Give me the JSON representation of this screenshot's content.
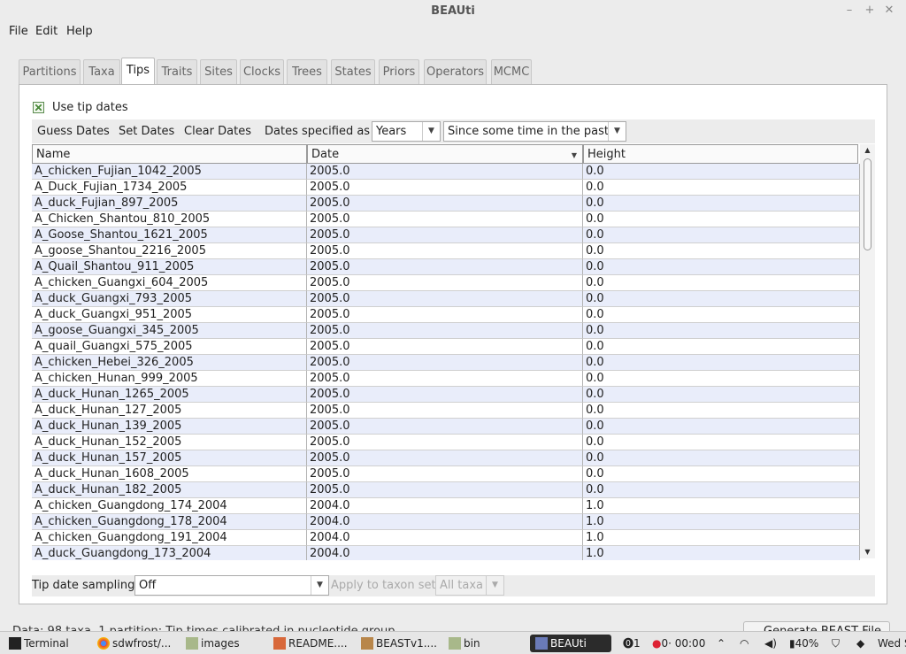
{
  "window": {
    "title": "BEAUti"
  },
  "menu": [
    "File",
    "Edit",
    "Help"
  ],
  "tabs": [
    "Partitions",
    "Taxa",
    "Tips",
    "Traits",
    "Sites",
    "Clocks",
    "Trees",
    "States",
    "Priors",
    "Operators",
    "MCMC"
  ],
  "active_tab": "Tips",
  "tips": {
    "use_tip_dates_label": "Use tip dates",
    "use_tip_dates_checked": true,
    "toolbar": {
      "guess_dates": "Guess Dates",
      "set_dates": "Set Dates",
      "clear_dates": "Clear Dates",
      "dates_specified_as": "Dates specified as",
      "units": "Years",
      "direction": "Since some time in the past"
    },
    "table": {
      "columns": [
        "Name",
        "Date",
        "Height"
      ],
      "rows": [
        [
          "A_chicken_Fujian_1042_2005",
          "2005.0",
          "0.0"
        ],
        [
          "A_Duck_Fujian_1734_2005",
          "2005.0",
          "0.0"
        ],
        [
          "A_duck_Fujian_897_2005",
          "2005.0",
          "0.0"
        ],
        [
          "A_Chicken_Shantou_810_2005",
          "2005.0",
          "0.0"
        ],
        [
          "A_Goose_Shantou_1621_2005",
          "2005.0",
          "0.0"
        ],
        [
          "A_goose_Shantou_2216_2005",
          "2005.0",
          "0.0"
        ],
        [
          "A_Quail_Shantou_911_2005",
          "2005.0",
          "0.0"
        ],
        [
          "A_chicken_Guangxi_604_2005",
          "2005.0",
          "0.0"
        ],
        [
          "A_duck_Guangxi_793_2005",
          "2005.0",
          "0.0"
        ],
        [
          "A_duck_Guangxi_951_2005",
          "2005.0",
          "0.0"
        ],
        [
          "A_goose_Guangxi_345_2005",
          "2005.0",
          "0.0"
        ],
        [
          "A_quail_Guangxi_575_2005",
          "2005.0",
          "0.0"
        ],
        [
          "A_chicken_Hebei_326_2005",
          "2005.0",
          "0.0"
        ],
        [
          "A_chicken_Hunan_999_2005",
          "2005.0",
          "0.0"
        ],
        [
          "A_duck_Hunan_1265_2005",
          "2005.0",
          "0.0"
        ],
        [
          "A_duck_Hunan_127_2005",
          "2005.0",
          "0.0"
        ],
        [
          "A_duck_Hunan_139_2005",
          "2005.0",
          "0.0"
        ],
        [
          "A_duck_Hunan_152_2005",
          "2005.0",
          "0.0"
        ],
        [
          "A_duck_Hunan_157_2005",
          "2005.0",
          "0.0"
        ],
        [
          "A_duck_Hunan_1608_2005",
          "2005.0",
          "0.0"
        ],
        [
          "A_duck_Hunan_182_2005",
          "2005.0",
          "0.0"
        ],
        [
          "A_chicken_Guangdong_174_2004",
          "2004.0",
          "1.0"
        ],
        [
          "A_chicken_Guangdong_178_2004",
          "2004.0",
          "1.0"
        ],
        [
          "A_chicken_Guangdong_191_2004",
          "2004.0",
          "1.0"
        ],
        [
          "A_duck_Guangdong_173_2004",
          "2004.0",
          "1.0"
        ]
      ]
    },
    "sampling": {
      "label": "Tip date sampling:",
      "value": "Off",
      "apply_label": "Apply to taxon set:",
      "apply_value": "All taxa"
    }
  },
  "status": {
    "text": "Data: 98 taxa, 1 partition; Tip times calibrated in nucleotide group",
    "generate_button": "Generate BEAST File..."
  },
  "taskbar": {
    "items": [
      "Terminal",
      "sdwfrost/...",
      "images",
      "README....",
      "BEASTv1....",
      "bin",
      "BEAUti"
    ],
    "tray": {
      "alerts": "1",
      "timer": "0· 00:00",
      "battery": "40%",
      "clock": "Wed S"
    }
  }
}
